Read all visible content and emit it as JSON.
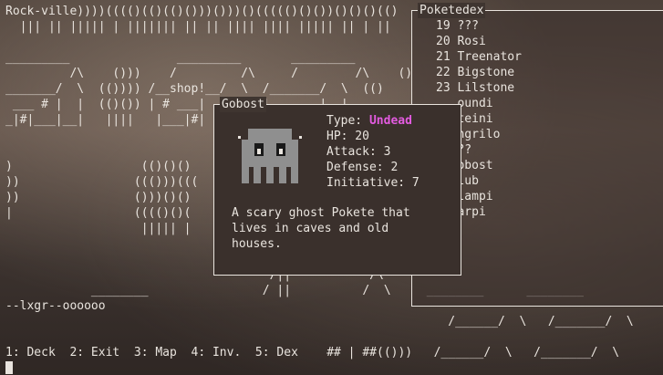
{
  "map": {
    "location": "Rock-ville",
    "art": "Rock-ville))))(((()(()(()()))()))()((((()()())()()()(()\n  ||| || ||||| | ||||||| || || |||| |||| ||||| || | ||\n\n_________               _________       _________\n         /\\    ()))    /         /\\     /        /\\    ()\n_______/  \\  (()))) /__shop!__/  \\  /_______/  \\  (()\n ___ # |  |  (()()) | # ___|   |  | |  ___  |  |\n_|#|___|__|   ||||   |___|#|   |  | |__|#|__|  |\n\n\n)                  (()()()\n))                ((()))(((\n))                ()))()()\n|                 (((()()(\n                   ||||| |\n\n                                      ._______________\n                                     /||           /\\\n            ________                / ||          /  \\     ________      ________\n--lxgr--oooooo\n                                                              /______/  \\   /_______/  \\"
  },
  "pokedex": {
    "title": "Poketedex",
    "entries": [
      "19 ???",
      "20 Rosi",
      "21 Treenator",
      "22 Bigstone",
      "23 Lilstone",
      "   oundi",
      "   teini",
      "   ngrilo",
      "   ??",
      "   obost",
      "   lub",
      "   lampi",
      "   arpi"
    ]
  },
  "detail": {
    "name": "Gobost",
    "sprite": "ghost-pokete",
    "type_label": "Type: ",
    "type_value": "Undead",
    "type_color": "#e35be0",
    "hp": "HP: 20",
    "attack": "Attack: 3",
    "defense": "Defense: 2",
    "initiative": "Initiative: 7",
    "description": "A scary ghost Pokete that\nlives in caves and old\nhouses."
  },
  "statusbar": {
    "player": "--lxgr--oooooo"
  },
  "menu": {
    "text": "1: Deck  2: Exit  3: Map  4: Inv.  5: Dex    ## | ##(()))   /______/  \\   /_______/  \\"
  }
}
